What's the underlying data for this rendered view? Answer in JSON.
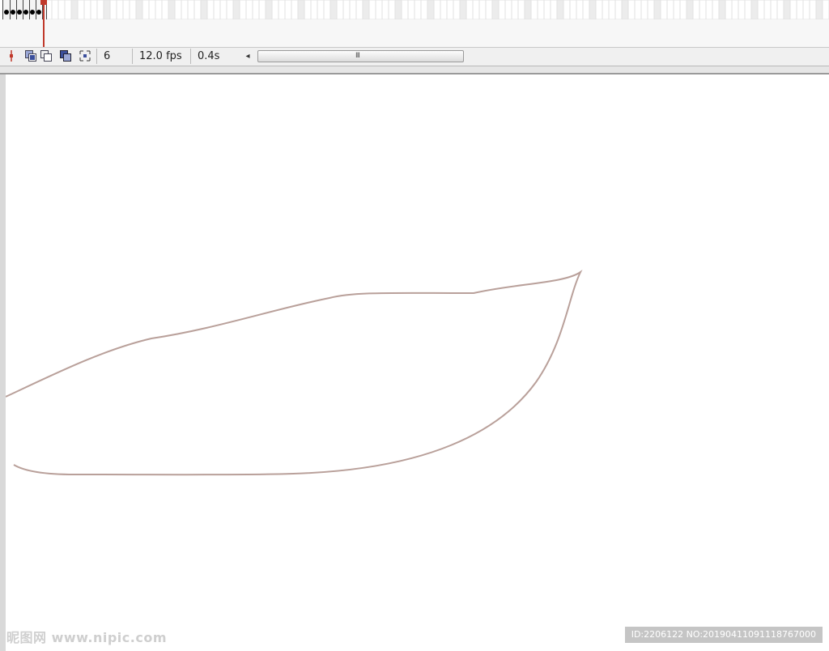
{
  "timeline": {
    "keyframe_count": 6,
    "current_frame": "6"
  },
  "status": {
    "frame": "6",
    "fps": "12.0 fps",
    "elapsed": "0.4s"
  },
  "scrollbar": {
    "left_arrow": "◂",
    "grip": "III"
  },
  "icons": {
    "playhead_center": "center-frame-icon",
    "onion_skin": "onion-skin-icon",
    "onion_skin_outlines": "onion-skin-outlines-icon",
    "edit_multiple": "edit-multiple-frames-icon",
    "modify_markers": "modify-onion-markers-icon"
  },
  "colors": {
    "stroke": "#b9a09a",
    "playhead": "#c0392b"
  },
  "watermark": {
    "logo": "昵图网 www.nipic.com",
    "id": "ID:2206122 NO:20190411091118767000"
  }
}
